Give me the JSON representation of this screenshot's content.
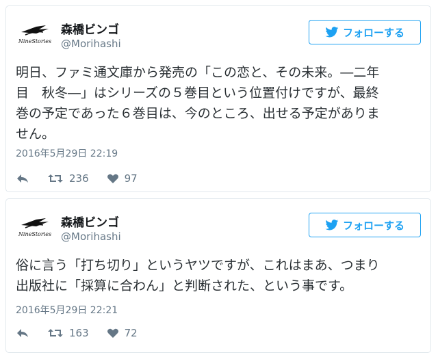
{
  "colors": {
    "accent": "#1da1f2",
    "text": "#292f33",
    "muted": "#657786",
    "border": "#e1e8ed"
  },
  "tweets": [
    {
      "avatar_icon": "nine-stories-logo",
      "avatar_text": "NineStories",
      "name": "森橋ビンゴ",
      "handle": "@Morihashi",
      "follow_label": "フォローする",
      "text_lines": [
        "明日、ファミ通文庫から発売の「この恋と、その未来。―二年",
        "目　秋冬―」はシリーズの５巻目という位置付けですが、最終",
        "巻の予定であった６巻目は、今のところ、出せる予定がありま",
        "せん。"
      ],
      "time": "2016年5月29日 22:19",
      "retweets": "236",
      "likes": "97"
    },
    {
      "avatar_icon": "nine-stories-logo",
      "avatar_text": "NineStories",
      "name": "森橋ビンゴ",
      "handle": "@Morihashi",
      "follow_label": "フォローする",
      "text_lines": [
        "俗に言う「打ち切り」というヤツですが、これはまあ、つまり",
        "出版社に「採算に合わん」と判断された、という事です。"
      ],
      "time": "2016年5月29日 22:21",
      "retweets": "163",
      "likes": "72"
    }
  ]
}
